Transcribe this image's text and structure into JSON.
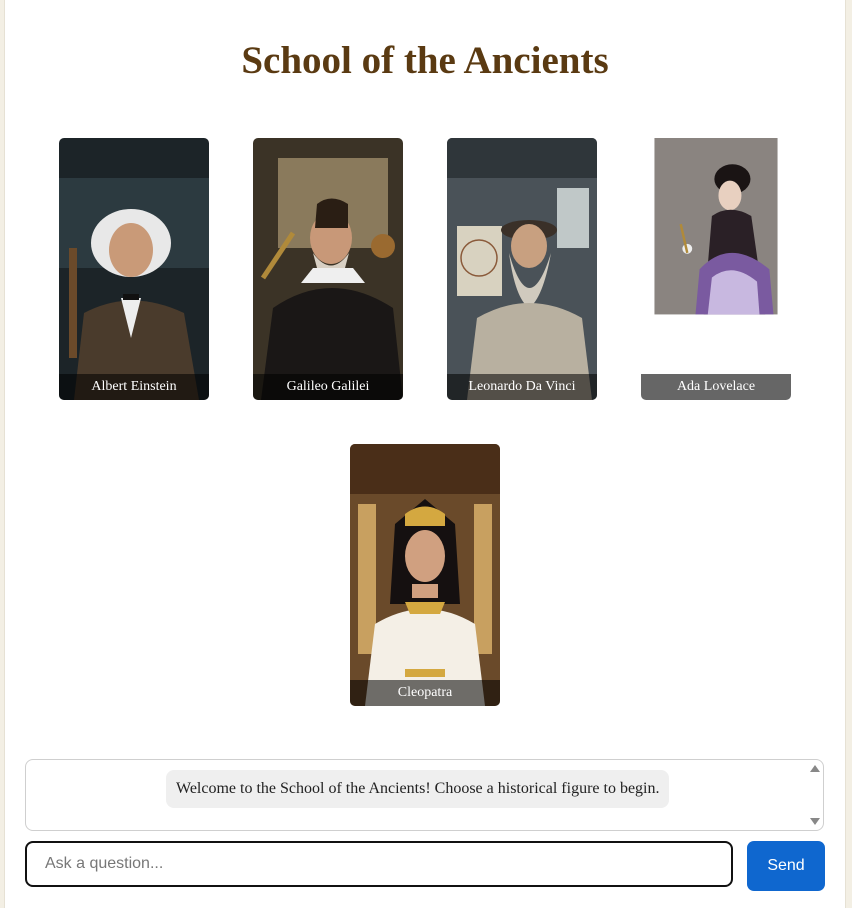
{
  "app": {
    "title": "School of the Ancients"
  },
  "figures": [
    {
      "name": "Albert Einstein"
    },
    {
      "name": "Galileo Galilei"
    },
    {
      "name": "Leonardo Da Vinci"
    },
    {
      "name": "Ada Lovelace"
    },
    {
      "name": "Cleopatra"
    }
  ],
  "chat": {
    "messages": [
      {
        "text": "Welcome to the School of the Ancients! Choose a historical figure to begin."
      }
    ]
  },
  "composer": {
    "placeholder": "Ask a question...",
    "send_label": "Send"
  },
  "colors": {
    "title": "#5a3a12",
    "send_button": "#0f67cf",
    "background": "#f3efe4"
  }
}
